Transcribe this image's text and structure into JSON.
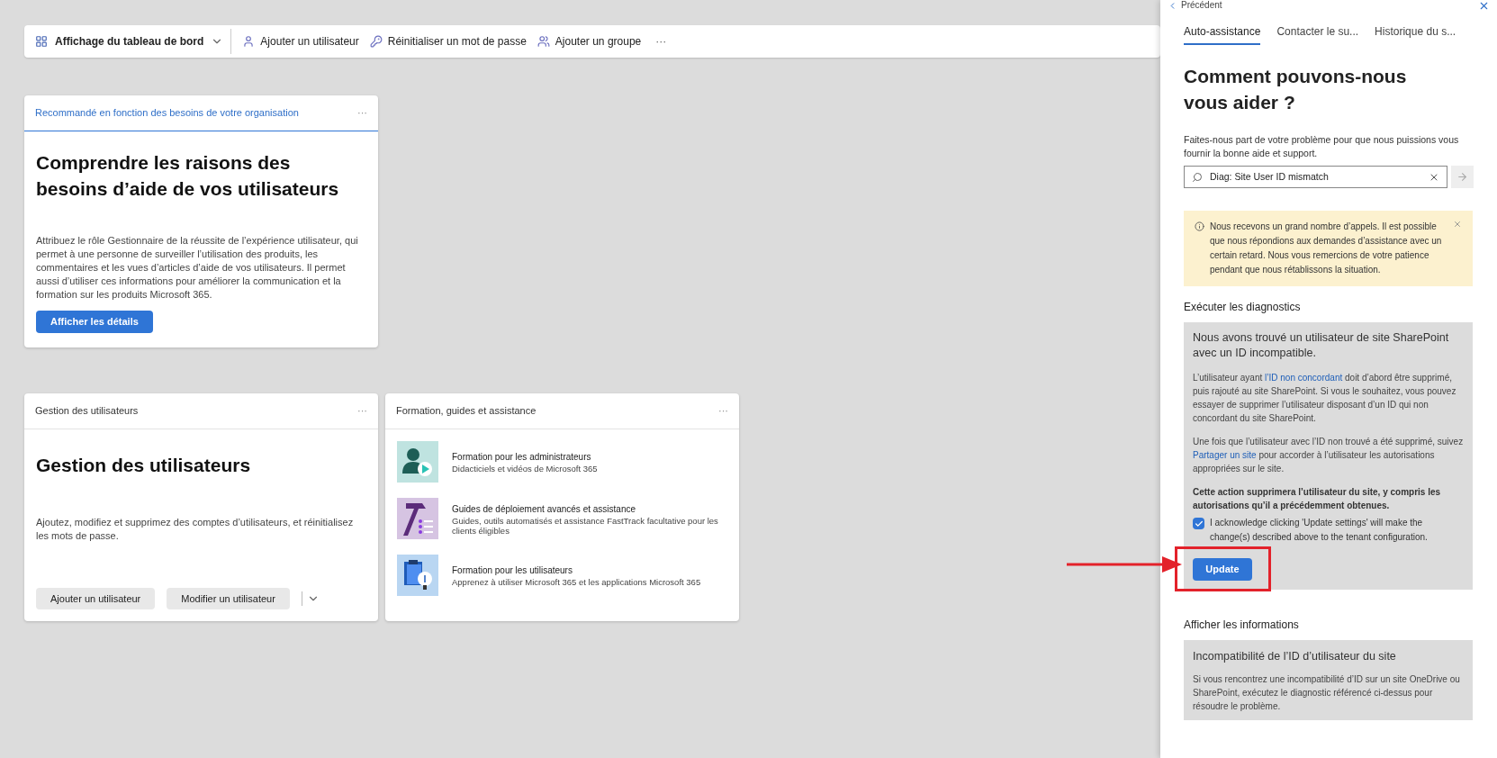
{
  "toolbar": {
    "view_menu": "Affichage du tableau de bord",
    "actions": [
      {
        "kind": "user",
        "label": "Ajouter un utilisateur"
      },
      {
        "kind": "key",
        "label": "Réinitialiser un mot de passe"
      },
      {
        "kind": "group",
        "label": "Ajouter un groupe"
      }
    ],
    "more": "···"
  },
  "recommended_card": {
    "header": "Recommandé en fonction des besoins de votre organisation",
    "more": "···",
    "title": "Comprendre les raisons des besoins d’aide de vos utilisateurs",
    "body": "Attribuez le rôle Gestionnaire de la réussite de l’expérience utilisateur, qui permet à une personne de surveiller l’utilisation des produits, les commentaires et les vues d’articles d’aide de vos utilisateurs. Il permet aussi d’utiliser ces informations pour améliorer la communication et la formation sur les produits Microsoft 365.",
    "button": "Afficher les détails"
  },
  "users_card": {
    "header": "Gestion des utilisateurs",
    "more": "···",
    "title": "Gestion des utilisateurs",
    "body": "Ajoutez, modifiez et supprimez des comptes d’utilisateurs, et réinitialisez les mots de passe.",
    "buttons": [
      "Ajouter un utilisateur",
      "Modifier un utilisateur"
    ]
  },
  "training_card": {
    "header": "Formation, guides et assistance",
    "more": "···",
    "items": [
      {
        "kind": "admin",
        "title": "Formation pour les administrateurs",
        "subtitle": "Didacticiels et vidéos de Microsoft 365"
      },
      {
        "kind": "deploy",
        "title": "Guides de déploiement avancés et assistance",
        "subtitle": "Guides, outils automatisés et assistance FastTrack facultative pour les clients éligibles"
      },
      {
        "kind": "user",
        "title": "Formation pour les utilisateurs",
        "subtitle": "Apprenez à utiliser Microsoft 365 et les applications Microsoft 365"
      }
    ]
  },
  "help_panel": {
    "back": "Précédent",
    "tabs": [
      {
        "label": "Auto-assistance",
        "selected": true
      },
      {
        "label": "Contacter le su...",
        "selected": false
      },
      {
        "label": "Historique du s...",
        "selected": false
      }
    ],
    "heading": "Comment pouvons-nous vous aider ?",
    "intro": "Faites-nous part de votre problème pour que nous puissions vous fournir la bonne aide et support.",
    "search": {
      "value": "Diag: Site User ID mismatch"
    },
    "notice": "Nous recevons un grand nombre d’appels. Il est possible que nous répondions aux demandes d’assistance avec un certain retard. Nous vous remercions de votre patience pendant que nous rétablissons la situation.",
    "diagnostics": {
      "section": "Exécuter les diagnostics",
      "title": "Nous avons trouvé un utilisateur de site SharePoint avec un ID incompatible.",
      "paragraphs": [
        [
          {
            "text": "L’utilisateur ayant "
          },
          {
            "text": "l’ID non concordant",
            "kind": "link"
          },
          {
            "text": " doit d’abord être supprimé, puis rajouté au site SharePoint. Si vous le souhaitez, vous pouvez essayer de supprimer l’utilisateur disposant d’un ID qui non concordant du site SharePoint."
          }
        ],
        [
          {
            "text": "Une fois que l’utilisateur avec l’ID non trouvé a été supprimé, suivez "
          },
          {
            "text": "Partager un site",
            "kind": "link"
          },
          {
            "text": " pour accorder à l’utilisateur les autorisations appropriées sur le site."
          }
        ]
      ],
      "warning": "Cette action supprimera l’utilisateur du site, y compris les autorisations qu’il a précédemment obtenues.",
      "acknowledge": {
        "label": "I acknowledge clicking 'Update settings' will make the change(s) described above to the tenant configuration.",
        "checked": true
      },
      "button": "Update"
    },
    "info": {
      "section": "Afficher les informations",
      "title": "Incompatibilité de l’ID d’utilisateur du site",
      "body": "Si vous rencontrez une incompatibilité d’ID sur un site OneDrive ou SharePoint, exécutez le diagnostic référencé ci-dessus pour résoudre le problème."
    }
  }
}
